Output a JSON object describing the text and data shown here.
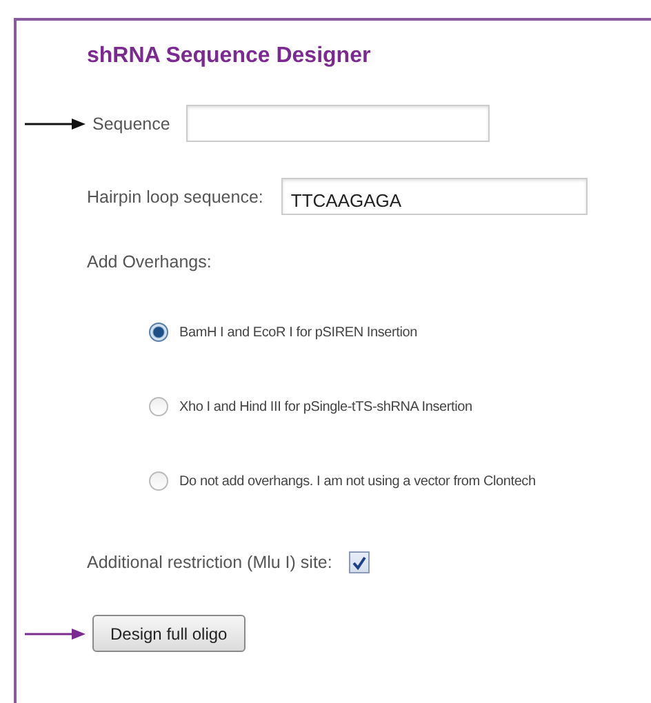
{
  "title": "shRNA Sequence Designer",
  "sequence": {
    "label": "Sequence",
    "pointer": true
  },
  "hairpin": {
    "label": "Hairpin loop sequence:",
    "value": "TTCAAGAGA"
  },
  "overhangs": {
    "label": "Add Overhangs:",
    "options": [
      {
        "label": "BamH I and EcoR I for pSIREN Insertion",
        "selected": true
      },
      {
        "label": "Xho I and Hind III for pSingle-tTS-shRNA Insertion",
        "selected": false
      },
      {
        "label": "Do not add overhangs. I am not using a vector from Clontech",
        "selected": false
      }
    ]
  },
  "restriction": {
    "label": "Additional restriction (Mlu I) site:",
    "checked": true
  },
  "submit": {
    "label": "Design full oligo",
    "pointer": true
  }
}
